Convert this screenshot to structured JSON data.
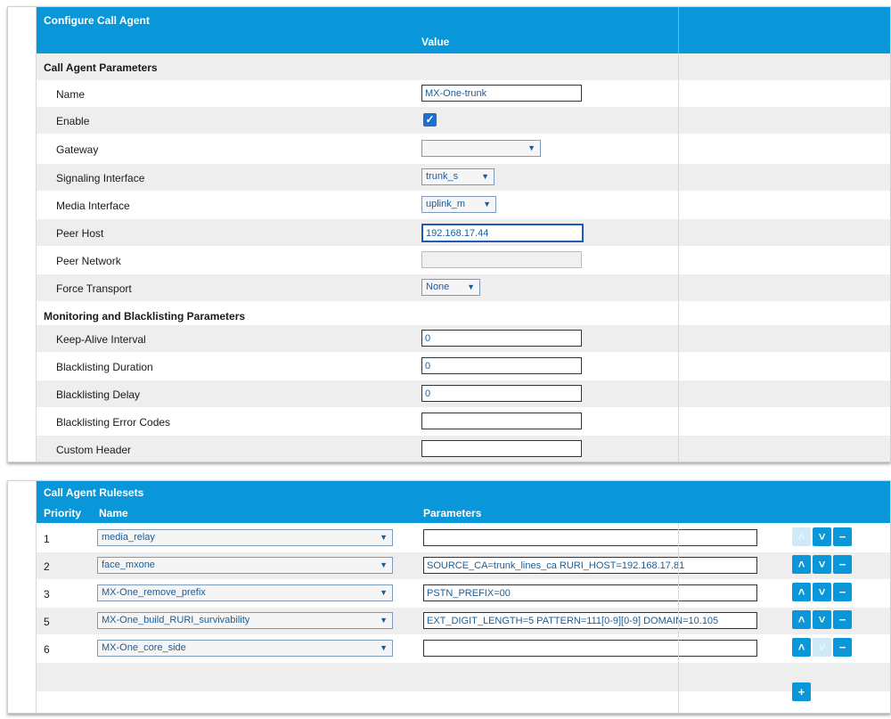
{
  "config": {
    "title": "Configure Call Agent",
    "value_header": "Value",
    "section1": "Call Agent Parameters",
    "name_label": "Name",
    "name_value": "MX-One-trunk",
    "enable_label": "Enable",
    "enable_checked": true,
    "gateway_label": "Gateway",
    "gateway_value": "",
    "signaling_label": "Signaling Interface",
    "signaling_value": "trunk_s",
    "media_label": "Media Interface",
    "media_value": "uplink_m",
    "peer_host_label": "Peer Host",
    "peer_host_value": "192.168.17.44",
    "peer_network_label": "Peer Network",
    "peer_network_value": "",
    "force_transport_label": "Force Transport",
    "force_transport_value": "None",
    "section2": "Monitoring and Blacklisting Parameters",
    "keepalive_label": "Keep-Alive Interval",
    "keepalive_value": "0",
    "bl_duration_label": "Blacklisting Duration",
    "bl_duration_value": "0",
    "bl_delay_label": "Blacklisting Delay",
    "bl_delay_value": "0",
    "bl_codes_label": "Blacklisting Error Codes",
    "bl_codes_value": "",
    "custom_header_label": "Custom Header",
    "custom_header_value": ""
  },
  "rulesets": {
    "title": "Call Agent Rulesets",
    "col_priority": "Priority",
    "col_name": "Name",
    "col_parameters": "Parameters",
    "rows": [
      {
        "priority": "1",
        "name": "media_relay",
        "parameters": ""
      },
      {
        "priority": "2",
        "name": "face_mxone",
        "parameters": "SOURCE_CA=trunk_lines_ca RURI_HOST=192.168.17.81"
      },
      {
        "priority": "3",
        "name": "MX-One_remove_prefix",
        "parameters": "PSTN_PREFIX=00"
      },
      {
        "priority": "5",
        "name": "MX-One_build_RURI_survivability",
        "parameters": "EXT_DIGIT_LENGTH=5 PATTERN=111[0-9][0-9] DOMAIN=10.105"
      },
      {
        "priority": "6",
        "name": "MX-One_core_side",
        "parameters": ""
      }
    ],
    "add_label": "+"
  },
  "icons": {
    "up": "chevron-up-icon",
    "down": "chevron-down-icon",
    "remove": "minus-icon",
    "add": "plus-icon",
    "check": "checkmark-icon"
  },
  "colors": {
    "accent": "#0a97d9",
    "checkbox": "#1f6fd1",
    "row_alt": "#eeeeee"
  }
}
